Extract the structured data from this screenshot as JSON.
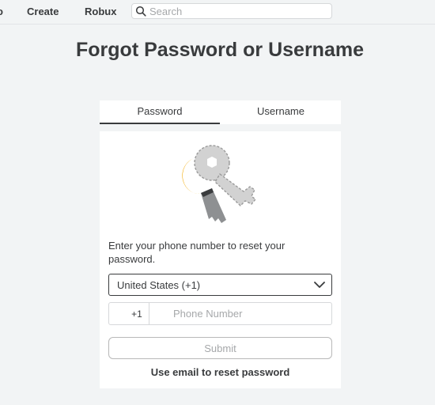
{
  "nav": {
    "partial_label": "o",
    "create_label": "Create",
    "robux_label": "Robux",
    "search": {
      "placeholder": "Search",
      "icon": "search-icon"
    }
  },
  "page": {
    "title": "Forgot Password or Username"
  },
  "tabs": [
    {
      "label": "Password",
      "selected": true
    },
    {
      "label": "Username",
      "selected": false
    }
  ],
  "form": {
    "illustration": "key-illustration",
    "instructions": "Enter your phone number to reset your password.",
    "country_select": {
      "value": "United States (+1)",
      "icon": "chevron-down-icon"
    },
    "phone": {
      "prefix": "+1",
      "placeholder": "Phone Number",
      "value": ""
    },
    "submit_label": "Submit",
    "alt_link_label": "Use email to reset password"
  },
  "colors": {
    "background": "#f2f4f5",
    "card": "#ffffff",
    "text": "#393b3d",
    "placeholder": "#a6a8aa",
    "key_silver": "#cfcfcf",
    "key_gold": "#f2a900"
  }
}
